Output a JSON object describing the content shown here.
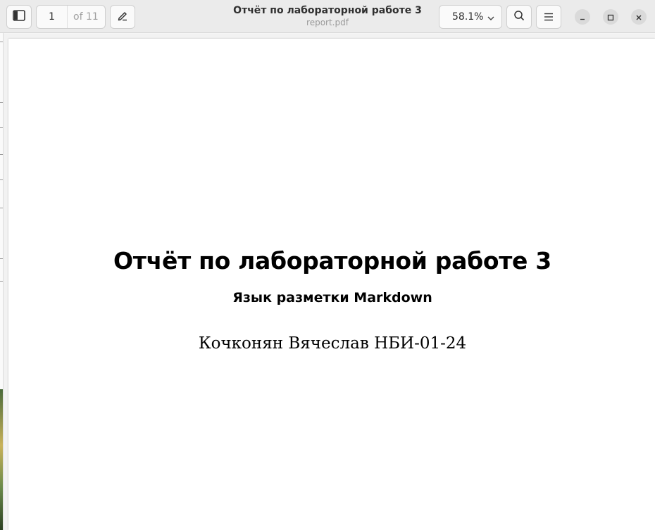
{
  "header": {
    "page_current": "1",
    "page_total_label": "of 11",
    "title": "Отчёт по лабораторной работе 3",
    "subtitle": "report.pdf",
    "zoom": "58.1%",
    "icons": {
      "sidebar": "sidebar-toggle-icon",
      "annotate": "pen-icon",
      "zoom_dropdown": "chevron-down-icon",
      "search": "search-icon",
      "menu": "hamburger-menu-icon",
      "minimize": "minimize-icon",
      "maximize": "maximize-icon",
      "close": "close-icon"
    }
  },
  "document": {
    "title": "Отчёт по лабораторной работе 3",
    "subtitle": "Язык разметки Markdown",
    "author": "Кочконян Вячеслав НБИ-01-24"
  }
}
